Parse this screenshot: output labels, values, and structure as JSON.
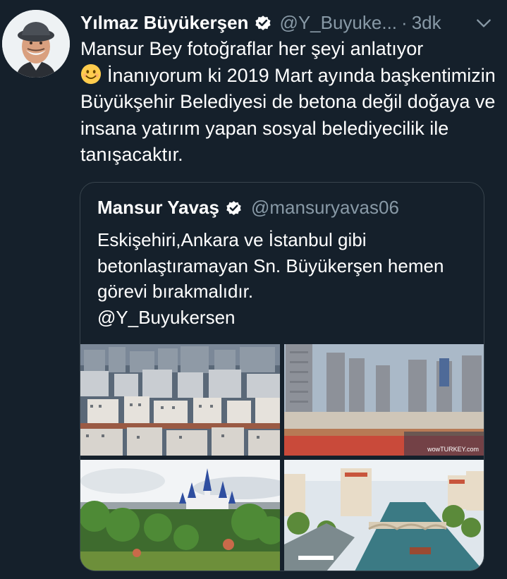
{
  "tweet": {
    "author_name": "Yılmaz Büyükerşen",
    "handle": "@Y_Buyuke...",
    "separator": "·",
    "time": "3dk",
    "text_line1": "Mansur Bey fotoğraflar her şeyi anlatıyor",
    "text_rest": "İnanıyorum ki 2019 Mart ayında başkentimizin Büyükşehir Belediyesi de betona değil doğaya ve insana yatırım yapan sosyal belediyecilik ile tanışacaktır.",
    "emoji": "smiling-face-emoji",
    "verified_icon": "verified-badge-icon",
    "menu_icon": "chevron-down-icon"
  },
  "quoted_tweet": {
    "author_name": "Mansur Yavaş",
    "handle": "@mansuryavas06",
    "text": "Eskişehiri,Ankara ve İstanbul gibi betonlaştıramayan Sn. Büyükerşen hemen görevi bırakmalıdır.",
    "mention": "@Y_Buyukersen",
    "images": [
      {
        "name": "dense-apartment-blocks-photo"
      },
      {
        "name": "high-rise-towers-photo",
        "watermark": "wowTURKEY.com"
      },
      {
        "name": "fairy-tale-castle-park-photo"
      },
      {
        "name": "river-city-bridge-photo"
      }
    ]
  },
  "colors": {
    "background": "#15202b",
    "text": "#ffffff",
    "secondary": "#8899a6",
    "border": "#38444d",
    "verified": "#ffffff"
  }
}
